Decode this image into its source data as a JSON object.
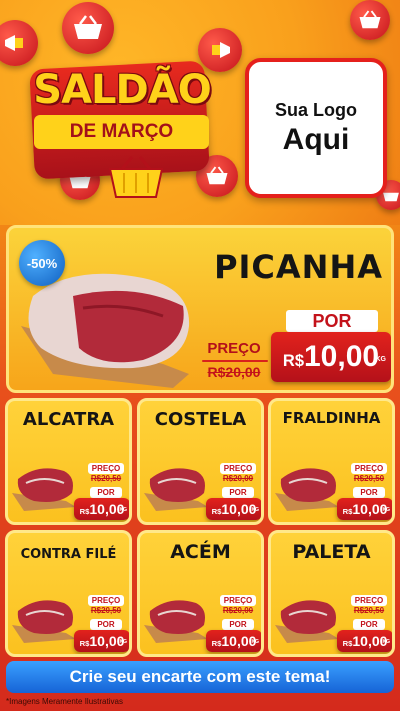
{
  "header": {
    "title_main": "SALDÃO",
    "title_sub": "DE MARÇO",
    "logo_line1": "Sua Logo",
    "logo_line2": "Aqui"
  },
  "hero": {
    "discount": "-50%",
    "name": "PICANHA",
    "preco_label": "PREÇO",
    "old_price": "R$20,00",
    "por_label": "POR",
    "currency": "R$",
    "new_price": "10,00",
    "unit": "KG"
  },
  "products": [
    {
      "name": "ALCATRA",
      "preco_label": "PREÇO",
      "old_price": "R$20,50",
      "por_label": "POR",
      "currency": "R$",
      "new_price": "10,00",
      "unit": "KG"
    },
    {
      "name": "COSTELA",
      "preco_label": "PREÇO",
      "old_price": "R$20,00",
      "por_label": "POR",
      "currency": "R$",
      "new_price": "10,00",
      "unit": "KG"
    },
    {
      "name": "FRALDINHA",
      "preco_label": "PREÇO",
      "old_price": "R$20,50",
      "por_label": "POR",
      "currency": "R$",
      "new_price": "10,00",
      "unit": "KG"
    },
    {
      "name": "CONTRA FILÉ",
      "preco_label": "PREÇO",
      "old_price": "R$20,50",
      "por_label": "POR",
      "currency": "R$",
      "new_price": "10,00",
      "unit": "KG"
    },
    {
      "name": "ACÉM",
      "preco_label": "PREÇO",
      "old_price": "R$20,00",
      "por_label": "POR",
      "currency": "R$",
      "new_price": "10,00",
      "unit": "KG"
    },
    {
      "name": "PALETA",
      "preco_label": "PREÇO",
      "old_price": "R$20,50",
      "por_label": "POR",
      "currency": "R$",
      "new_price": "10,00",
      "unit": "KG"
    }
  ],
  "footer": {
    "cta": "Crie seu encarte com este tema!",
    "disclaimer": "*Imagens Meramente Ilustrativas"
  },
  "colors": {
    "accent_red": "#d9221c",
    "accent_yellow": "#ffd21a",
    "cta_blue": "#1663d6"
  },
  "icons": [
    "shopping-basket-icon",
    "megaphone-icon",
    "meat-cut-icon"
  ]
}
